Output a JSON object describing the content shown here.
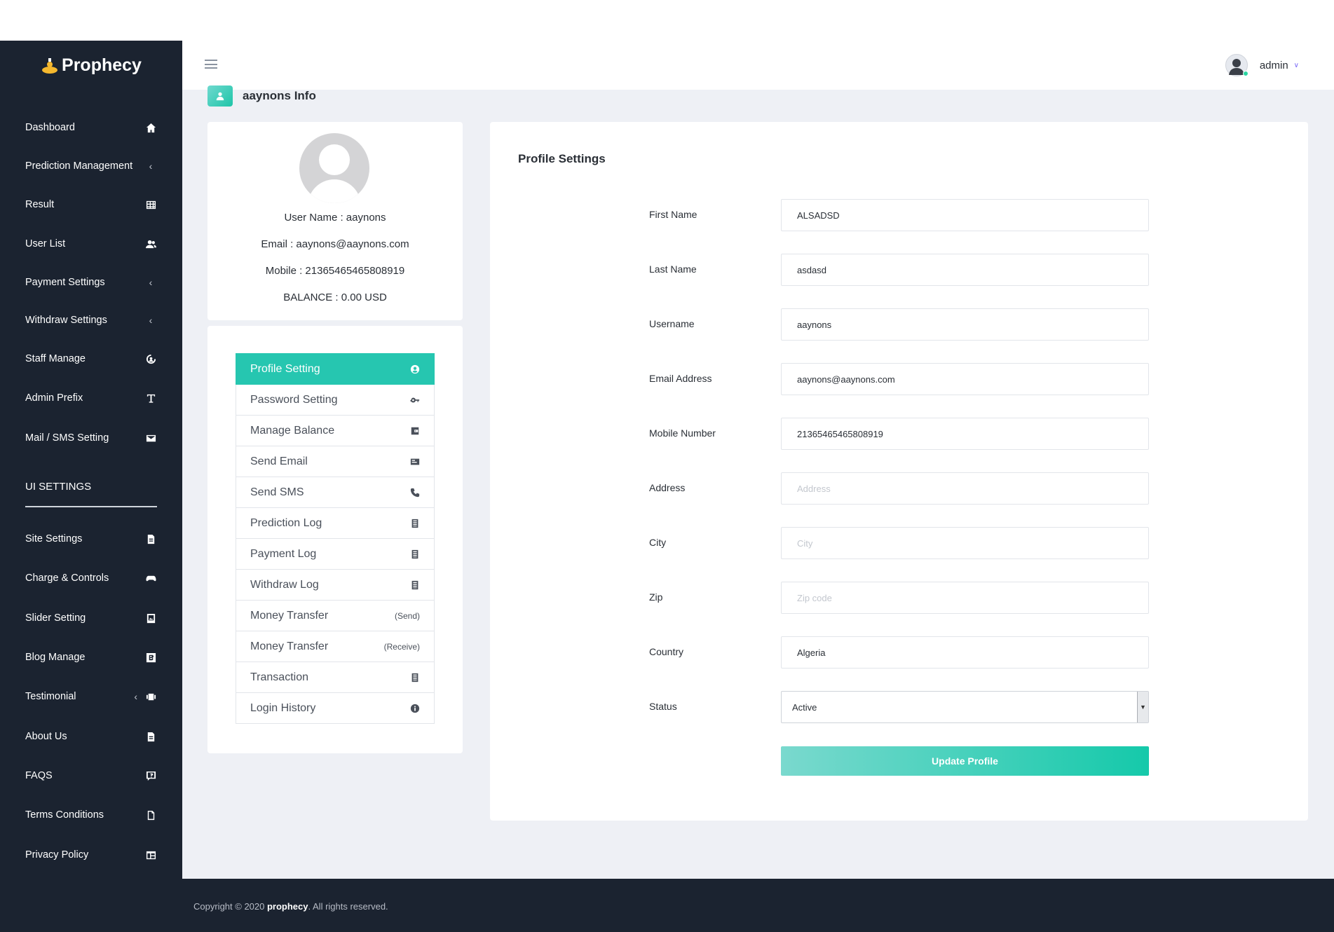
{
  "brand": {
    "name": "Prophecy"
  },
  "sidebar": {
    "items": [
      {
        "label": "Dashboard",
        "icon": "home-icon"
      },
      {
        "label": "Prediction Management",
        "icon": "chevron-left-icon"
      },
      {
        "label": "Result",
        "icon": "grid-icon"
      },
      {
        "label": "User List",
        "icon": "users-icon"
      },
      {
        "label": "Payment Settings",
        "icon": "chevron-left-icon"
      },
      {
        "label": "Withdraw Settings",
        "icon": "chevron-left-icon"
      },
      {
        "label": "Staff Manage",
        "icon": "staff-icon"
      },
      {
        "label": "Admin Prefix",
        "icon": "text-icon"
      },
      {
        "label": "Mail / SMS Setting",
        "icon": "mail-icon"
      }
    ],
    "ui_section": "UI SETTINGS",
    "ui_items": [
      {
        "label": "Site Settings",
        "icon": "document-icon"
      },
      {
        "label": "Charge & Controls",
        "icon": "gamepad-icon"
      },
      {
        "label": "Slider Setting",
        "icon": "image-icon"
      },
      {
        "label": "Blog Manage",
        "icon": "blog-icon"
      },
      {
        "label": "Testimonial",
        "icon": "quote-icon"
      },
      {
        "label": "About Us",
        "icon": "document-icon"
      },
      {
        "label": "FAQS",
        "icon": "help-icon"
      },
      {
        "label": "Terms Conditions",
        "icon": "file-icon"
      },
      {
        "label": "Privacy Policy",
        "icon": "layout-icon"
      }
    ]
  },
  "topbar": {
    "user_name": "admin"
  },
  "breadcrumb": {
    "title": "aaynons Info"
  },
  "user_info": {
    "username": "User Name : aaynons",
    "email": "Email : aaynons@aaynons.com",
    "mobile": "Mobile : 21365465465808919",
    "balance": "BALANCE : 0.00 USD"
  },
  "user_menu": [
    {
      "label": "Profile Setting",
      "icon": "profile-icon",
      "active": true
    },
    {
      "label": "Password Setting",
      "icon": "key-icon"
    },
    {
      "label": "Manage Balance",
      "icon": "wallet-icon"
    },
    {
      "label": "Send Email",
      "icon": "email-icon"
    },
    {
      "label": "Send SMS",
      "icon": "phone-icon"
    },
    {
      "label": "Prediction Log",
      "icon": "log-icon"
    },
    {
      "label": "Payment Log",
      "icon": "log-icon"
    },
    {
      "label": "Withdraw Log",
      "icon": "log-icon"
    },
    {
      "label": "Money Transfer",
      "suffix": "(Send)"
    },
    {
      "label": "Money Transfer",
      "suffix": "(Receive)"
    },
    {
      "label": "Transaction",
      "icon": "log-icon"
    },
    {
      "label": "Login History",
      "icon": "info-icon"
    }
  ],
  "profile_settings": {
    "title": "Profile Settings",
    "fields": [
      {
        "label": "First Name",
        "value": "ALSADSD",
        "placeholder": ""
      },
      {
        "label": "Last Name",
        "value": "asdasd",
        "placeholder": ""
      },
      {
        "label": "Username",
        "value": "aaynons",
        "placeholder": ""
      },
      {
        "label": "Email Address",
        "value": "aaynons@aaynons.com",
        "placeholder": ""
      },
      {
        "label": "Mobile Number",
        "value": "21365465465808919",
        "placeholder": ""
      },
      {
        "label": "Address",
        "value": "",
        "placeholder": "Address"
      },
      {
        "label": "City",
        "value": "",
        "placeholder": "City"
      },
      {
        "label": "Zip",
        "value": "",
        "placeholder": "Zip code"
      },
      {
        "label": "Country",
        "value": "Algeria",
        "placeholder": ""
      }
    ],
    "status": {
      "label": "Status",
      "value": "Active"
    },
    "submit_label": "Update Profile"
  },
  "footer": {
    "prefix": "Copyright © 2020 ",
    "brand": "prophecy",
    "suffix": ". All rights reserved."
  },
  "colors": {
    "sidebar_bg": "#1b2330",
    "accent": "#26c6b0",
    "main_bg": "#eef0f5",
    "online_dot": "#2bd6a2"
  }
}
